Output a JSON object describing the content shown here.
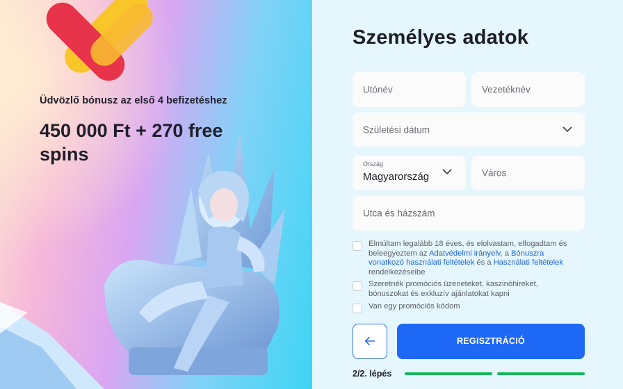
{
  "promo": {
    "subtitle": "Üdvözlő bónusz az első 4 befizetéshez",
    "headline": "450 000 Ft + 270 free spins"
  },
  "form": {
    "title": "Személyes adatok",
    "first_name_placeholder": "Utónév",
    "last_name_placeholder": "Vezetéknév",
    "birthdate_placeholder": "Születési dátum",
    "country_label": "Ország",
    "country_value": "Magyarország",
    "city_placeholder": "Város",
    "street_placeholder": "Utca és házszám"
  },
  "consents": {
    "terms": {
      "prefix": "Elmúltam legalább 18 éves, és elolvastam, elfogadtam és beleegyeztem az ",
      "privacy_link": "Adatvédelmi irányelv",
      "middle1": ", a ",
      "bonus_link": "Bónuszra vonatkozó használati feltételek",
      "middle2": " és a ",
      "usage_link": "Használati feltételek",
      "suffix": " rendelkezéseibe"
    },
    "promo_text": "Szeretnék promóciós üzeneteket, kaszinóhireket, bónuszokat és exkluzív ajánlatokat kapni",
    "promo_code_text": "Van egy promóciós kódom"
  },
  "actions": {
    "back_icon": "arrow-left-icon",
    "register_label": "REGISZTRÁCIÓ"
  },
  "progress": {
    "step_label": "2/2. lépés",
    "current_step": 2,
    "total_steps": 2
  },
  "colors": {
    "accent": "#1e68f6",
    "progress": "#15b85a",
    "link": "#1f64d6"
  }
}
